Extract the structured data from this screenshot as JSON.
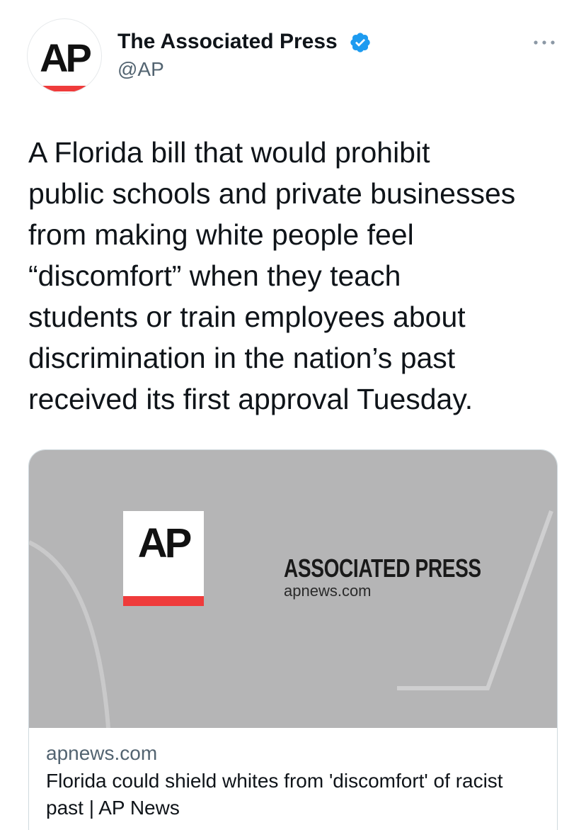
{
  "header": {
    "display_name": "The Associated Press",
    "handle": "@AP",
    "avatar_text": "AP",
    "verified_icon": "verified-badge-icon",
    "more_icon": "more-options-icon"
  },
  "tweet": {
    "text_lines": [
      "A Florida bill that would prohibit",
      "public schools and private businesses",
      "from making white people feel",
      "“discomfort” when they teach",
      "students or train employees about",
      "discrimination in the nation’s past",
      "received its first approval Tuesday."
    ]
  },
  "card": {
    "image": {
      "logo_text": "AP",
      "title": "ASSOCIATED PRESS",
      "domain": "apnews.com"
    },
    "domain": "apnews.com",
    "title": "Florida could shield whites from 'discomfort' of racist past | AP News"
  },
  "colors": {
    "verified_blue": "#1d9bf0",
    "ap_red": "#ef3b3b",
    "card_image_bg": "#b5b5b6",
    "secondary_text": "#536471"
  }
}
